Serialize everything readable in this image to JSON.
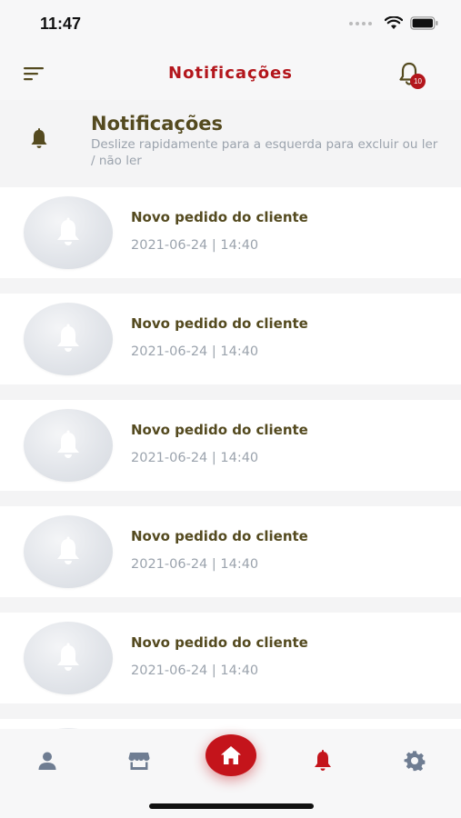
{
  "status_bar": {
    "time": "11:47"
  },
  "header": {
    "title": "Notificações",
    "badge_count": "10",
    "accent_color": "#b3161c"
  },
  "section": {
    "title": "Notificações",
    "subtitle": "Deslize rapidamente para a esquerda para excluir ou ler / não ler"
  },
  "notifications": [
    {
      "title": "Novo pedido do cliente",
      "date": "2021-06-24 | 14:40"
    },
    {
      "title": "Novo pedido do cliente",
      "date": "2021-06-24 | 14:40"
    },
    {
      "title": "Novo pedido do cliente",
      "date": "2021-06-24 | 14:40"
    },
    {
      "title": "Novo pedido do cliente",
      "date": "2021-06-24 | 14:40"
    },
    {
      "title": "Novo pedido do cliente",
      "date": "2021-06-24 | 14:40"
    }
  ],
  "tab_bar": {
    "items": [
      {
        "icon": "user-icon",
        "active": false
      },
      {
        "icon": "store-icon",
        "active": false
      },
      {
        "icon": "home-icon",
        "active": false,
        "center": true
      },
      {
        "icon": "bell-icon",
        "active": true
      },
      {
        "icon": "gear-icon",
        "active": false
      }
    ],
    "active_color": "#c4141b",
    "inactive_color": "#6f7d92"
  }
}
